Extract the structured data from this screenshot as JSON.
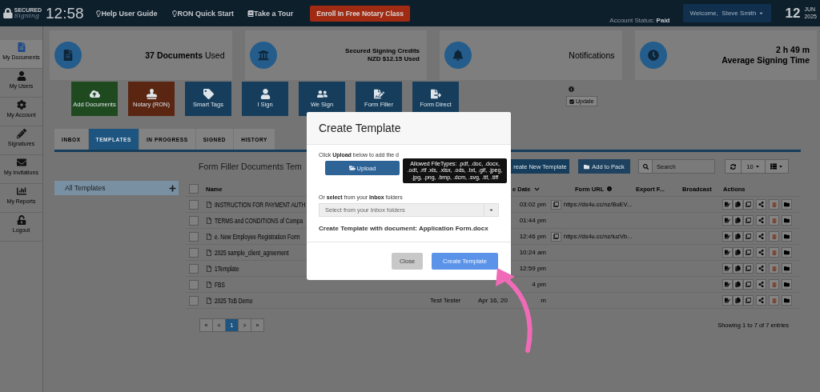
{
  "top_bar": {
    "logo": {
      "line1": "SECURED",
      "line2": "Signing"
    },
    "time": "12:58",
    "links": [
      "Help User Guide",
      "RON Quick Start",
      "Take a Tour"
    ],
    "enroll_button": "Enroll In Free Notary Class",
    "account_status": "Account Status: **Paid**",
    "welcome": "Welcome,  Steve Smith",
    "date": {
      "day": "12",
      "month": "JUN",
      "year": "2025"
    }
  },
  "sidebar": {
    "items": [
      {
        "label": "My Documents",
        "selected": true
      },
      {
        "label": "My Users",
        "selected": false
      },
      {
        "label": "My Account",
        "selected": false
      },
      {
        "label": "Signatures",
        "selected": false
      },
      {
        "label": "My Invitations",
        "selected": false
      },
      {
        "label": "My Reports",
        "selected": false
      },
      {
        "label": "Logout",
        "selected": false
      }
    ]
  },
  "stats": [
    {
      "lines": [
        "**37 Documents** Used"
      ]
    },
    {
      "lines": [
        "Secured Signing Credits",
        "NZD $12.15 Used"
      ]
    },
    {
      "lines": [
        "Notifications"
      ]
    },
    {
      "lines": [
        "2 h 49 m",
        "Average Signing Time"
      ]
    }
  ],
  "actions": [
    {
      "label": "Add Documents",
      "color": "#1f4a1f"
    },
    {
      "label": "Notary (RON)",
      "color": "#5a2511"
    },
    {
      "label": "Smart Tags",
      "color": "#163e5c"
    },
    {
      "label": "I Sign",
      "color": "#163e5c"
    },
    {
      "label": "We Sign",
      "color": "#163e5c"
    },
    {
      "label": "Form Filler",
      "color": "#163e5c"
    },
    {
      "label": "Form Direct",
      "color": "#163e5c"
    }
  ],
  "update_button": "Update",
  "tabs": [
    {
      "label": "INBOX",
      "selected": false
    },
    {
      "label": "TEMPLATES",
      "selected": true
    },
    {
      "label": "IN PROGRESS",
      "selected": false
    },
    {
      "label": "SIGNED",
      "selected": false
    },
    {
      "label": "HISTORY",
      "selected": false
    }
  ],
  "folders": {
    "items": [
      "All Templates"
    ]
  },
  "heading": "Form Filler Documents Tem",
  "toolbar": {
    "create_button": "reate New Template",
    "add_to_pack": "Add to Pack",
    "search": {
      "placeholder": "Search"
    },
    "page_size": "10"
  },
  "table": {
    "select_all": {
      "checked": false
    },
    "columns": [
      "Name",
      "e Date",
      "Form URL",
      "Export F...",
      "Broadcast",
      "Actions"
    ],
    "rows": [
      {
        "checked": false,
        "name": "INSTRUCTION FOR PAYMENT AUTH",
        "time": "03:02 pm",
        "url": "https://ds4u.cc/nz/BuEV..."
      },
      {
        "checked": false,
        "name": "TERMS and CONDITIONS of Compa",
        "time": "01:44 pm"
      },
      {
        "checked": false,
        "name": "e. New Employee Registration Form",
        "time": "12:46 pm",
        "url": "https://ds4u.cc/nz/iuzVb..."
      },
      {
        "checked": false,
        "name": "2025 sample_client_agreement",
        "time": "10:24 am"
      },
      {
        "checked": false,
        "name": "1Template",
        "time": "12:59 pm"
      },
      {
        "checked": false,
        "name": "FBS",
        "time": "4 pm"
      },
      {
        "checked": false,
        "name": "2025 ToB Demo",
        "author": "Test Tester",
        "date": "Apr 16, 20",
        "time": "m"
      }
    ]
  },
  "pagination": [
    {
      "label": "«",
      "selected": false
    },
    {
      "label": "<",
      "selected": false
    },
    {
      "label": "1",
      "selected": true
    },
    {
      "label": ">",
      "selected": false
    },
    {
      "label": "»",
      "selected": false
    }
  ],
  "entries": "Showing 1 to 7 of 7 entries",
  "modal": {
    "title": "Create Template",
    "intro": "Click **Upload** below to add the d",
    "upload_button": "Upload",
    "tooltip": "Allowed FileTypes: .pdf, .doc, .docx, .odt, .rtf .xls, .xlsx, .ods, .txt, .gif, .jpeg, .jpg, .png, .bmp, .dcm, .svg, .tif, .tiff",
    "or_text": "Or **select** from your **Inbox** folders",
    "select": {
      "placeholder": "Select from your Inbox folders"
    },
    "document_line": "Create Template with document: Application Form.docx",
    "buttons": [
      {
        "label": "Close",
        "kind": "secondary"
      },
      {
        "label": "Create Template",
        "kind": "primary"
      }
    ]
  }
}
